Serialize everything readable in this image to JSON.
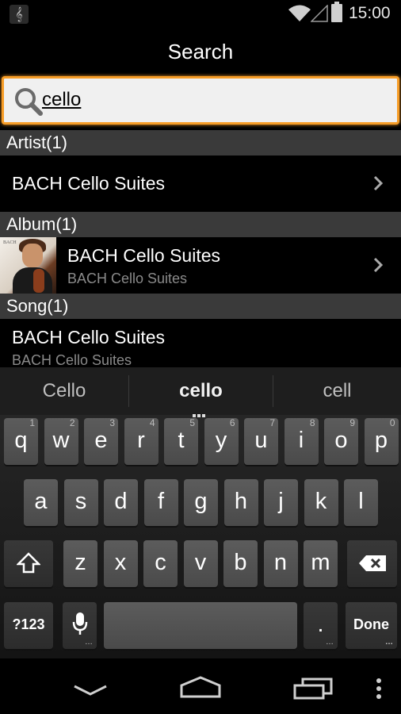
{
  "status_bar": {
    "app_icon": "music-note-icon",
    "time": "15:00"
  },
  "header": {
    "title": "Search"
  },
  "search": {
    "value": "cello",
    "icon": "search-icon",
    "accent": "#f79d27"
  },
  "sections": {
    "artist": {
      "header": "Artist(1)",
      "rows": [
        {
          "title": "BACH Cello Suites"
        }
      ]
    },
    "album": {
      "header": "Album(1)",
      "rows": [
        {
          "title": "BACH Cello Suites",
          "subtitle": "BACH Cello Suites"
        }
      ]
    },
    "song": {
      "header": "Song(1)",
      "rows": [
        {
          "title": "BACH Cello Suites",
          "subtitle": "BACH Cello Suites"
        }
      ]
    }
  },
  "keyboard": {
    "suggestions": [
      "Cello",
      "cello",
      "cell"
    ],
    "row1": [
      {
        "k": "q",
        "h": "1"
      },
      {
        "k": "w",
        "h": "2"
      },
      {
        "k": "e",
        "h": "3"
      },
      {
        "k": "r",
        "h": "4"
      },
      {
        "k": "t",
        "h": "5"
      },
      {
        "k": "y",
        "h": "6"
      },
      {
        "k": "u",
        "h": "7"
      },
      {
        "k": "i",
        "h": "8"
      },
      {
        "k": "o",
        "h": "9"
      },
      {
        "k": "p",
        "h": "0"
      }
    ],
    "row2": [
      "a",
      "s",
      "d",
      "f",
      "g",
      "h",
      "j",
      "k",
      "l"
    ],
    "row3": [
      "z",
      "x",
      "c",
      "v",
      "b",
      "n",
      "m"
    ],
    "symbols_label": "?123",
    "period_label": ".",
    "done_label": "Done"
  }
}
